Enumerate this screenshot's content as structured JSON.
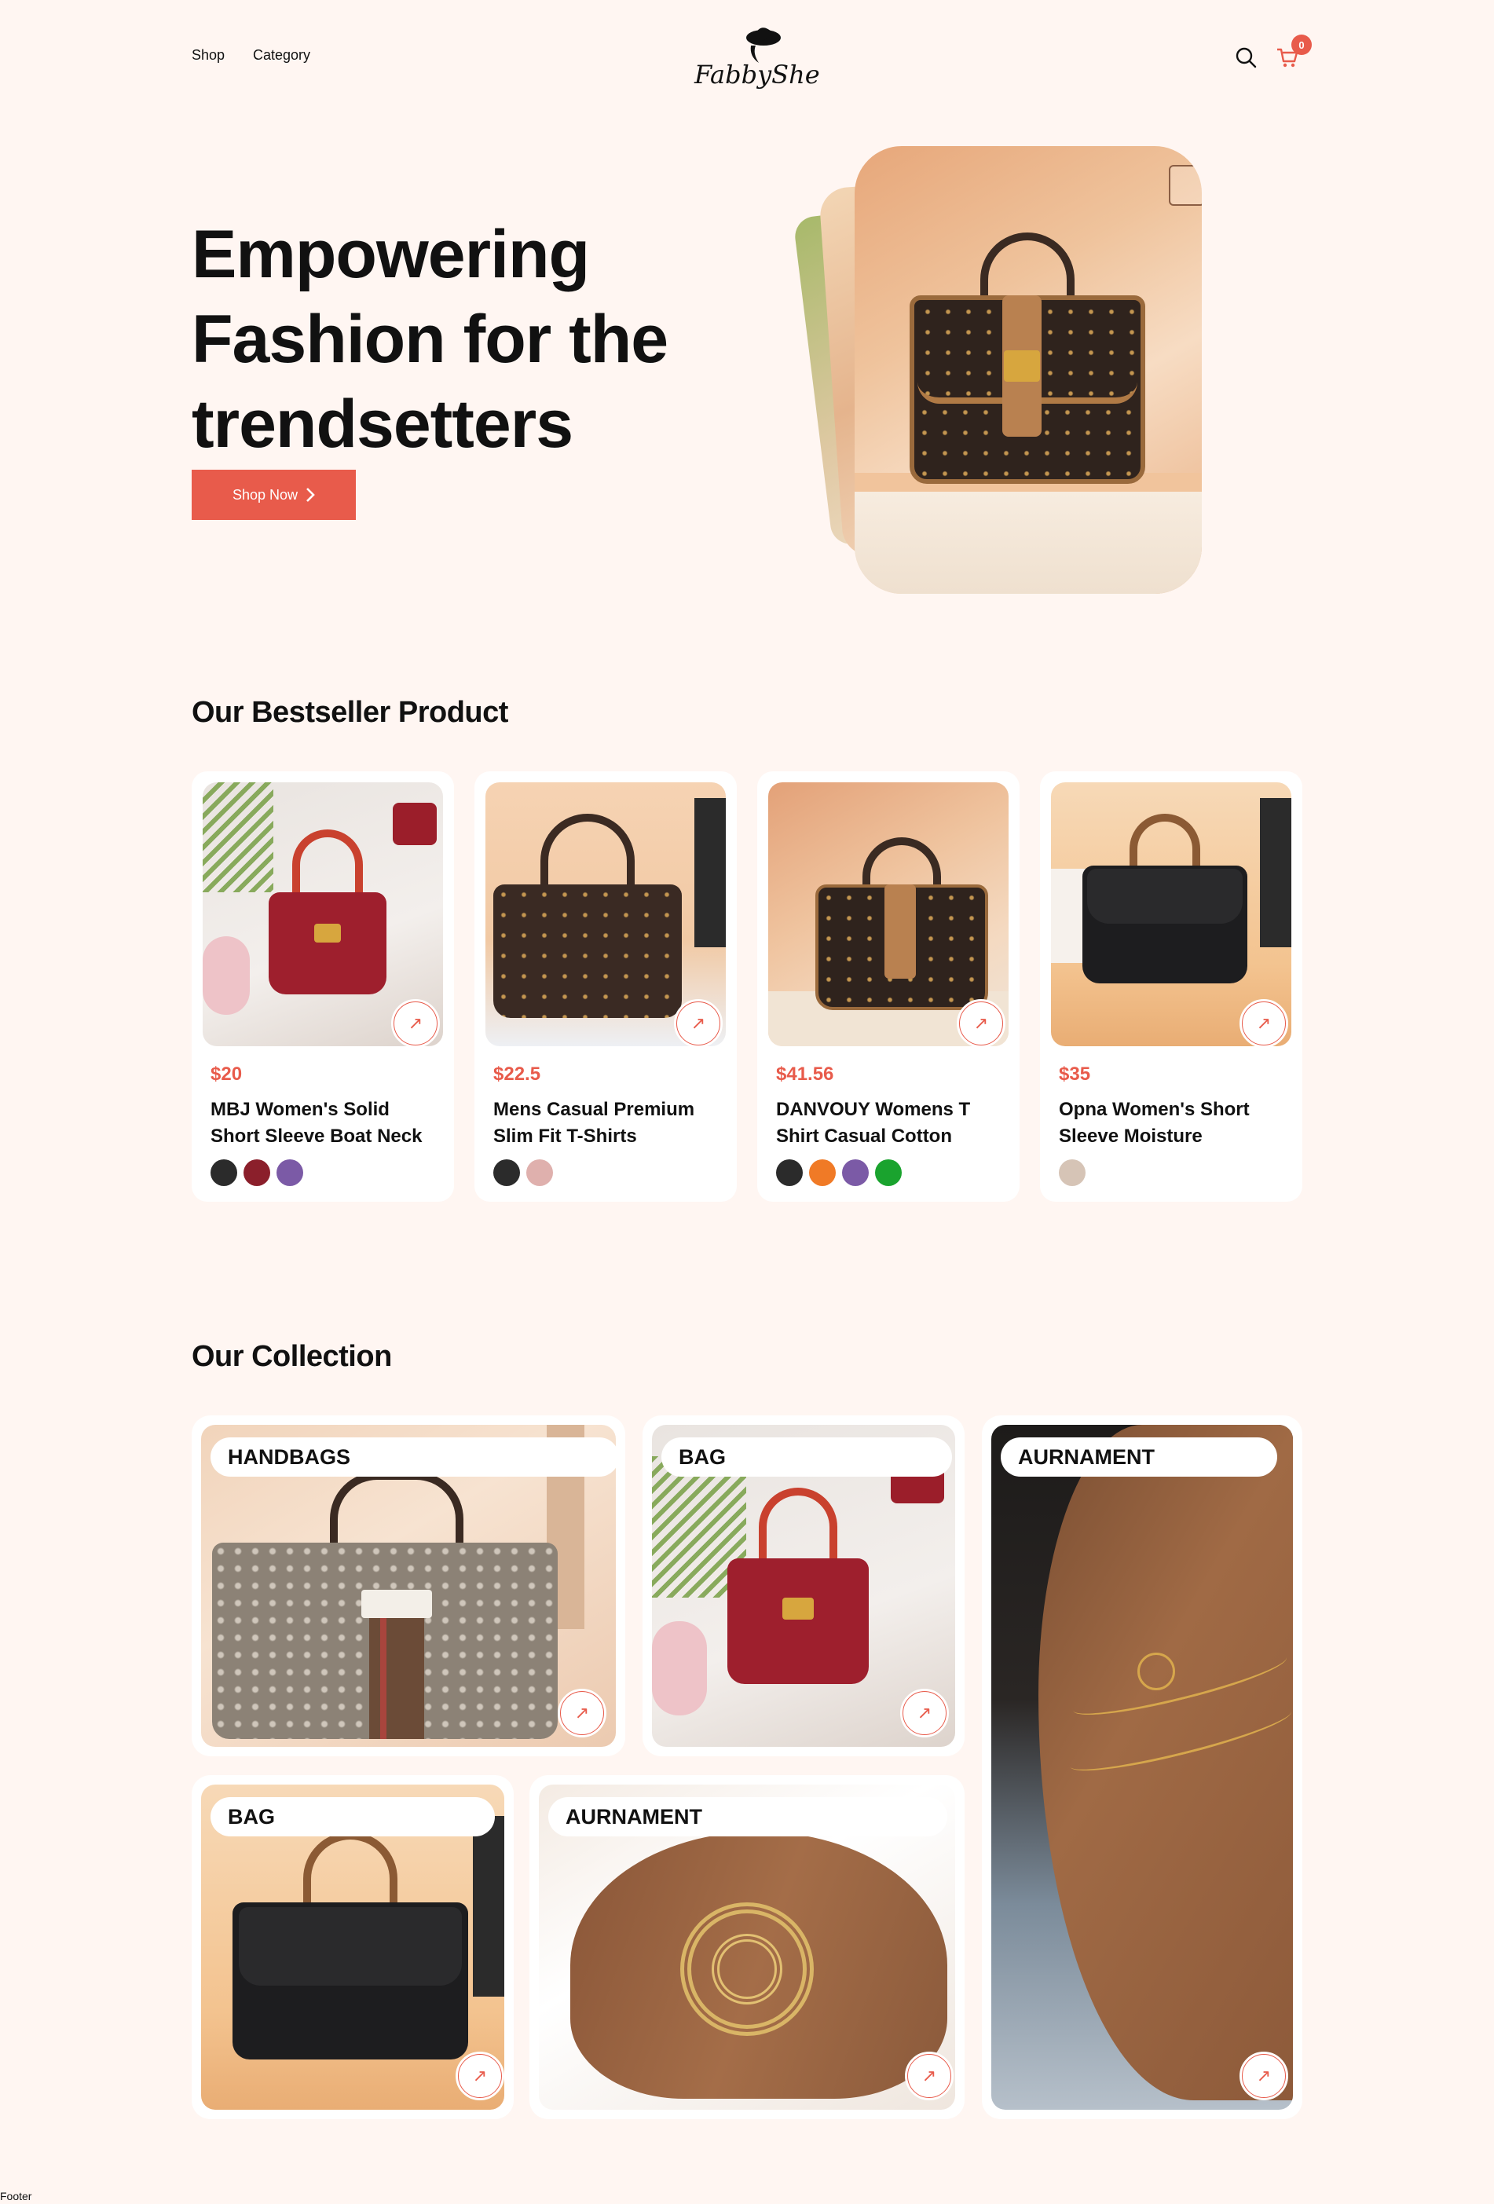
{
  "header": {
    "nav": [
      {
        "label": "Shop"
      },
      {
        "label": "Category"
      }
    ],
    "logo_text": "FabbyShe",
    "cart_count": "0"
  },
  "hero": {
    "title": "Empowering Fashion for the trendsetters",
    "cta_label": "Shop Now",
    "cta_icon": "chevron-right-icon"
  },
  "bestseller": {
    "title": "Our Bestseller Product",
    "products": [
      {
        "price": "$20",
        "name": "MBJ Women's Solid Short Sleeve Boat Neck",
        "colors": [
          "#2b2b2b",
          "#8b1f2b",
          "#7b5aa6"
        ]
      },
      {
        "price": "$22.5",
        "name": "Mens Casual Premium Slim Fit T-Shirts",
        "colors": [
          "#2b2b2b",
          "#dfb0ad"
        ]
      },
      {
        "price": "$41.56",
        "name": "DANVOUY Womens T Shirt Casual Cotton",
        "colors": [
          "#2b2b2b",
          "#f07a26",
          "#7b5aa6",
          "#1aa32e"
        ]
      },
      {
        "price": "$35",
        "name": "Opna Women's Short Sleeve Moisture",
        "colors": [
          "#d6c4b6"
        ]
      }
    ]
  },
  "collection": {
    "title": "Our Collection",
    "items": [
      {
        "label": "HANDBAGS"
      },
      {
        "label": "BAG"
      },
      {
        "label": "AURNAMENT"
      },
      {
        "label": "BAG"
      },
      {
        "label": "AURNAMENT"
      }
    ]
  },
  "footer": {
    "label": "Footer"
  },
  "colors": {
    "accent": "#e85b4b",
    "background": "#fff6f2"
  }
}
